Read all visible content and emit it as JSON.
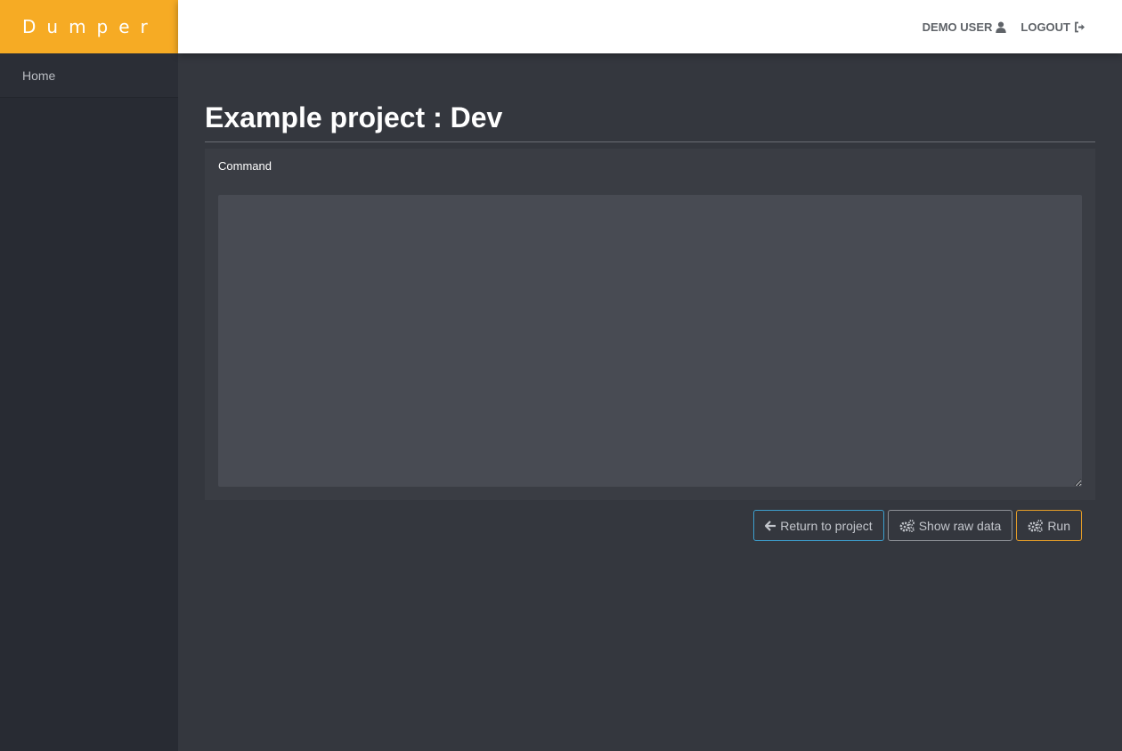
{
  "brand": {
    "name": "Dumper",
    "color": "#f6ab24"
  },
  "header": {
    "user_label": "DEMO USER",
    "user_icon": "user-icon",
    "logout_label": "LOGOUT",
    "logout_icon": "sign-out-icon"
  },
  "sidebar": {
    "items": [
      {
        "label": "Home"
      }
    ]
  },
  "main": {
    "title": "Example project : Dev",
    "form": {
      "command_label": "Command",
      "command_value": "",
      "command_placeholder": ""
    },
    "actions": {
      "return_label": "Return to project",
      "return_icon": "arrow-left-icon",
      "raw_label": "Show raw data",
      "raw_icon": "cogs-icon",
      "run_label": "Run",
      "run_icon": "cogs-icon"
    }
  },
  "colors": {
    "info": "#3d9ecd",
    "warning": "#e59d27",
    "sidebar_bg": "#282b33",
    "main_bg": "#34373e"
  }
}
